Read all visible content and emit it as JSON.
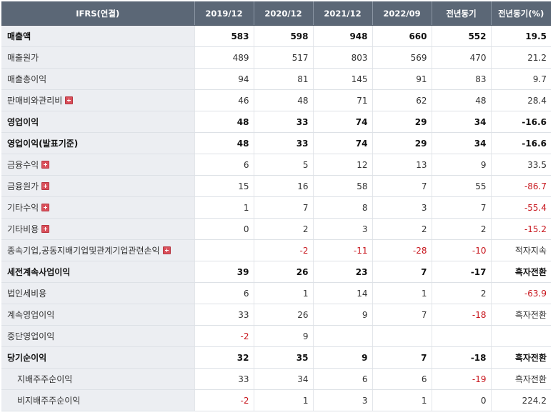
{
  "headers": [
    "IFRS(연결)",
    "2019/12",
    "2020/12",
    "2021/12",
    "2022/09",
    "전년동기",
    "전년동기(%)"
  ],
  "rows": [
    {
      "label": "매출액",
      "bold": true,
      "values": [
        "583",
        "598",
        "948",
        "660",
        "552",
        "19.5"
      ]
    },
    {
      "label": "매출원가",
      "values": [
        "489",
        "517",
        "803",
        "569",
        "470",
        "21.2"
      ]
    },
    {
      "label": "매출총이익",
      "values": [
        "94",
        "81",
        "145",
        "91",
        "83",
        "9.7"
      ]
    },
    {
      "label": "판매비와관리비",
      "expand": true,
      "values": [
        "46",
        "48",
        "71",
        "62",
        "48",
        "28.4"
      ]
    },
    {
      "label": "영업이익",
      "bold": true,
      "values": [
        "48",
        "33",
        "74",
        "29",
        "34",
        "-16.6"
      ]
    },
    {
      "label": "영업이익(발표기준)",
      "bold": true,
      "values": [
        "48",
        "33",
        "74",
        "29",
        "34",
        "-16.6"
      ]
    },
    {
      "label": "금융수익",
      "expand": true,
      "values": [
        "6",
        "5",
        "12",
        "13",
        "9",
        "33.5"
      ]
    },
    {
      "label": "금융원가",
      "expand": true,
      "values": [
        "15",
        "16",
        "58",
        "7",
        "55",
        "-86.7"
      ]
    },
    {
      "label": "기타수익",
      "expand": true,
      "values": [
        "1",
        "7",
        "8",
        "3",
        "7",
        "-55.4"
      ]
    },
    {
      "label": "기타비용",
      "expand": true,
      "values": [
        "0",
        "2",
        "3",
        "2",
        "2",
        "-15.2"
      ]
    },
    {
      "label": "종속기업,공동지배기업및관계기업관련손익",
      "expand": true,
      "values": [
        "",
        "-2",
        "-11",
        "-28",
        "-10",
        "적자지속"
      ]
    },
    {
      "label": "세전계속사업이익",
      "bold": true,
      "values": [
        "39",
        "26",
        "23",
        "7",
        "-17",
        "흑자전환"
      ]
    },
    {
      "label": "법인세비용",
      "values": [
        "6",
        "1",
        "14",
        "1",
        "2",
        "-63.9"
      ]
    },
    {
      "label": "계속영업이익",
      "values": [
        "33",
        "26",
        "9",
        "7",
        "-18",
        "흑자전환"
      ]
    },
    {
      "label": "중단영업이익",
      "values": [
        "-2",
        "9",
        "",
        "",
        "",
        ""
      ]
    },
    {
      "label": "당기순이익",
      "bold": true,
      "values": [
        "32",
        "35",
        "9",
        "7",
        "-18",
        "흑자전환"
      ]
    },
    {
      "label": "지배주주순이익",
      "indent": true,
      "values": [
        "33",
        "34",
        "6",
        "6",
        "-19",
        "흑자전환"
      ]
    },
    {
      "label": "비지배주주순이익",
      "indent": true,
      "values": [
        "-2",
        "1",
        "3",
        "1",
        "0",
        "224.2"
      ]
    }
  ]
}
